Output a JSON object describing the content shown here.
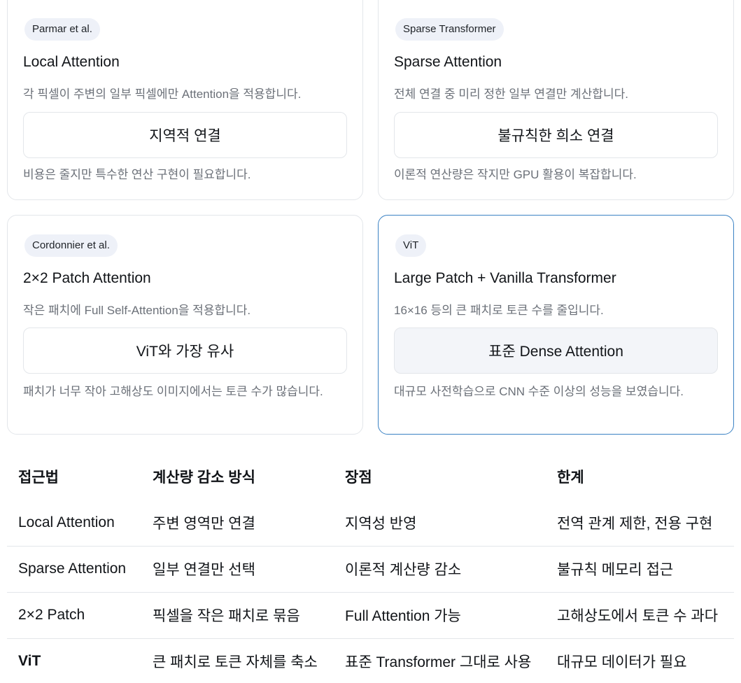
{
  "cards": [
    {
      "badge": "Parmar et al.",
      "title": "Local Attention",
      "desc": "각 픽셀이 주변의 일부 픽셀에만 Attention을 적용합니다.",
      "box": "지역적 연결",
      "note": "비용은 줄지만 특수한 연산 구현이 필요합니다."
    },
    {
      "badge": "Sparse Transformer",
      "title": "Sparse Attention",
      "desc": "전체 연결 중 미리 정한 일부 연결만 계산합니다.",
      "box": "불규칙한 희소 연결",
      "note": "이론적 연산량은 작지만 GPU 활용이 복잡합니다."
    },
    {
      "badge": "Cordonnier et al.",
      "title": "2×2 Patch Attention",
      "desc": "작은 패치에 Full Self-Attention을 적용합니다.",
      "box": "ViT와 가장 유사",
      "note": "패치가 너무 작아 고해상도 이미지에서는 토큰 수가 많습니다."
    },
    {
      "badge": "ViT",
      "title": "Large Patch + Vanilla Transformer",
      "desc": "16×16 등의 큰 패치로 토큰 수를 줄입니다.",
      "box": "표준 Dense Attention",
      "note": "대규모 사전학습으로 CNN 수준 이상의 성능을 보였습니다."
    }
  ],
  "table": {
    "headers": [
      "접근법",
      "계산량 감소 방식",
      "장점",
      "한계"
    ],
    "rows": [
      [
        "Local Attention",
        "주변 영역만 연결",
        "지역성 반영",
        "전역 관계 제한, 전용 구현"
      ],
      [
        "Sparse Attention",
        "일부 연결만 선택",
        "이론적 계산량 감소",
        "불규칙 메모리 접근"
      ],
      [
        "2×2 Patch",
        "픽셀을 작은 패치로 묶음",
        "Full Attention 가능",
        "고해상도에서 토큰 수 과다"
      ],
      [
        "ViT",
        "큰 패치로 토큰 자체를 축소",
        "표준 Transformer 그대로 사용",
        "대규모 데이터가 필요"
      ]
    ]
  },
  "colors": {
    "highlight_border": "#3b82c4",
    "badge_bg": "#eef1f8",
    "muted_text": "#6b7078",
    "border": "#e3e6ea"
  }
}
